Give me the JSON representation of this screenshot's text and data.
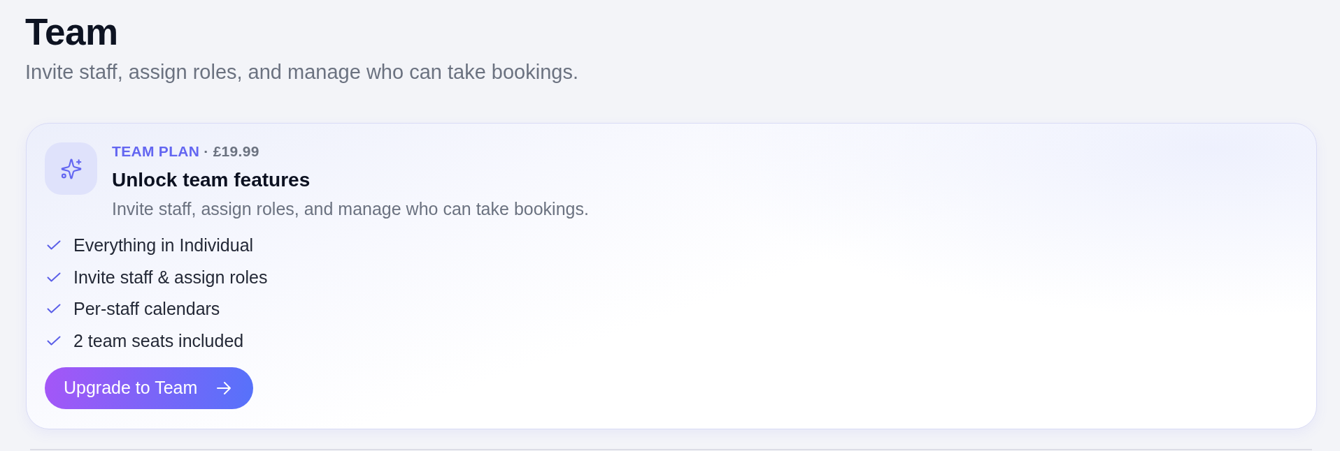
{
  "page": {
    "title": "Team",
    "subtitle": "Invite staff, assign roles, and manage who can take bookings."
  },
  "plan_card": {
    "plan_name": "TEAM PLAN",
    "price": "· £19.99",
    "title": "Unlock team features",
    "description": "Invite staff, assign roles, and manage who can take bookings.",
    "features": [
      "Everything in Individual",
      "Invite staff & assign roles",
      "Per-staff calendars",
      "2 team seats included"
    ],
    "button": {
      "label": "Upgrade to Team"
    }
  }
}
